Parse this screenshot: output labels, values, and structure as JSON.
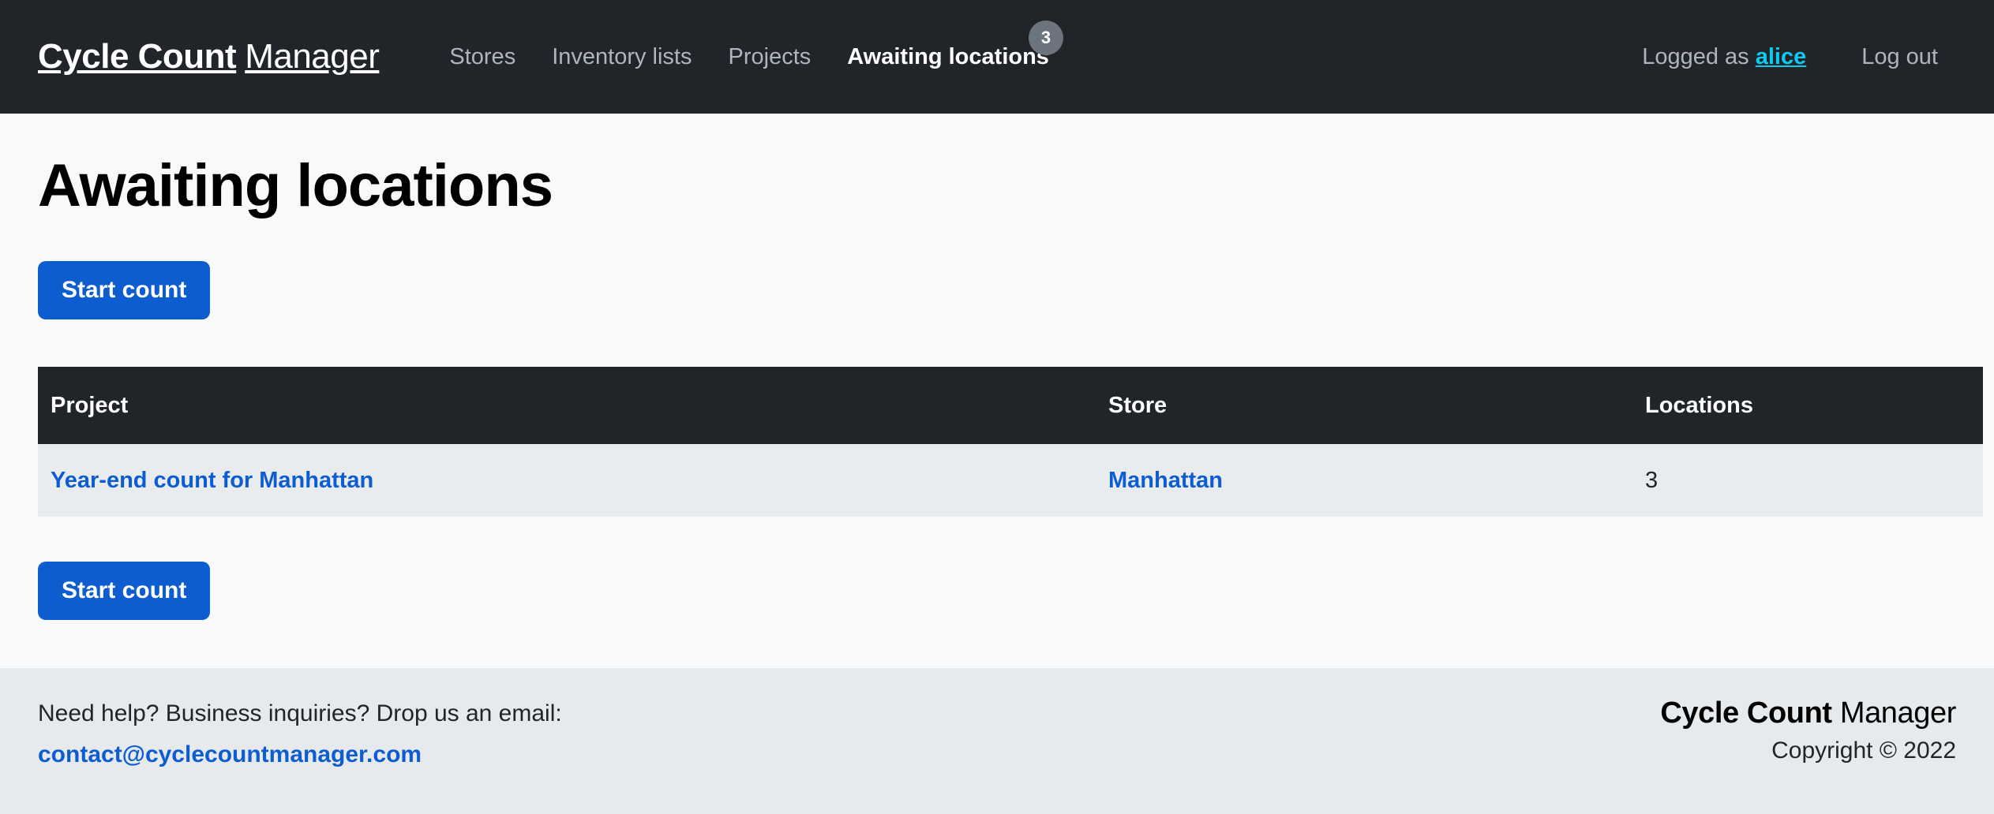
{
  "navbar": {
    "brand_strong": "Cycle Count",
    "brand_light": "Manager",
    "links": [
      {
        "label": "Stores",
        "active": false
      },
      {
        "label": "Inventory lists",
        "active": false
      },
      {
        "label": "Projects",
        "active": false
      },
      {
        "label": "Awaiting locations",
        "active": true,
        "badge": "3"
      }
    ],
    "logged_as_prefix": "Logged as",
    "user_name": "alice",
    "logout_label": "Log out",
    "badge_color": "#6c757d",
    "user_color": "#0dcaf0",
    "background": "#212529"
  },
  "main": {
    "page_title": "Awaiting locations",
    "start_count_top_label": "Start count",
    "start_count_bottom_label": "Start count",
    "primary_color": "#0d5dd1",
    "table": {
      "columns": [
        "Project",
        "Store",
        "Locations"
      ],
      "rows": [
        {
          "project": "Year-end count for Manhattan",
          "store": "Manhattan",
          "locations": "3"
        }
      ],
      "header_background": "#212529",
      "row_background": "#e9ecef",
      "link_color": "#0d5dd1"
    }
  },
  "footer": {
    "help_text": "Need help? Business inquiries? Drop us an email:",
    "email": "contact@cyclecountmanager.com",
    "brand_strong": "Cycle Count",
    "brand_light": "Manager",
    "copyright": "Copyright © 2022",
    "background": "#e7eaed"
  }
}
